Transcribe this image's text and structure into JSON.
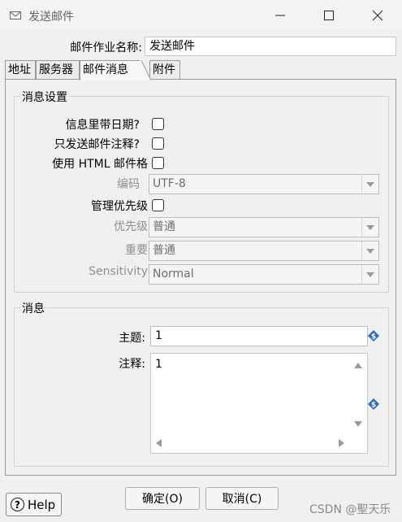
{
  "window": {
    "title": "发送邮件",
    "icon": "mail-icon"
  },
  "form": {
    "job_name_label": "邮件作业名称:",
    "job_name_value": "发送邮件"
  },
  "tabs": [
    "地址",
    "服务器",
    "邮件消息",
    "附件"
  ],
  "active_tab": "邮件消息",
  "message_settings": {
    "group_title": "消息设置",
    "include_date_label": "信息里带日期?",
    "include_date_checked": false,
    "only_comment_label": "只发送邮件注释?",
    "only_comment_checked": false,
    "html_format_label": "使用 HTML 邮件格",
    "html_format_checked": false,
    "encoding_label": "编码",
    "encoding_value": "UTF-8",
    "manage_priority_label": "管理优先级",
    "manage_priority_checked": false,
    "priority_label": "优先级",
    "priority_value": "普通",
    "importance_label": "重要",
    "importance_value": "普通",
    "sensitivity_label": "Sensitivity",
    "sensitivity_value": "Normal"
  },
  "message": {
    "group_title": "消息",
    "subject_label": "主题:",
    "subject_value": "1",
    "comment_label": "注释:",
    "comment_value": "1"
  },
  "buttons": {
    "help": "Help",
    "ok": "确定(O)",
    "cancel": "取消(C)"
  },
  "watermark": "CSDN @聖天乐"
}
